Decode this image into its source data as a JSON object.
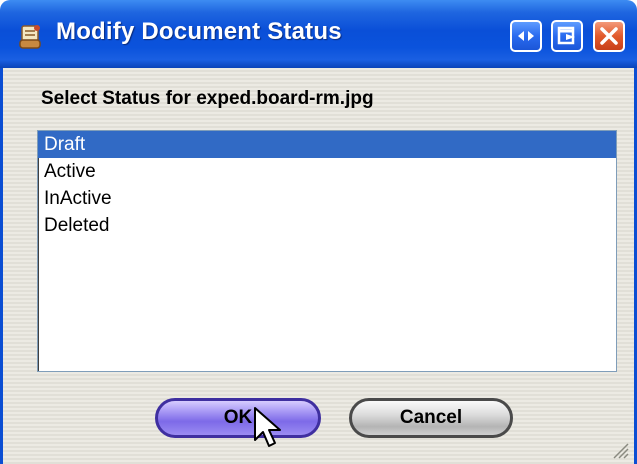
{
  "window": {
    "title": "Modify Document Status",
    "icon": "document-scroll-icon",
    "controls": [
      "resize-arrows-icon",
      "restore-icon",
      "close-icon"
    ]
  },
  "prompt": "Select Status for exped.board-rm.jpg",
  "status_list": {
    "items": [
      "Draft",
      "Active",
      "InActive",
      "Deleted"
    ],
    "selected": "Draft"
  },
  "buttons": {
    "ok_label": "OK",
    "cancel_label": "Cancel"
  },
  "colors": {
    "titlebar": "#0b53dc",
    "selection": "#316ac5",
    "ok_button": "#7d6ae8",
    "close_button": "#e25a2c"
  }
}
